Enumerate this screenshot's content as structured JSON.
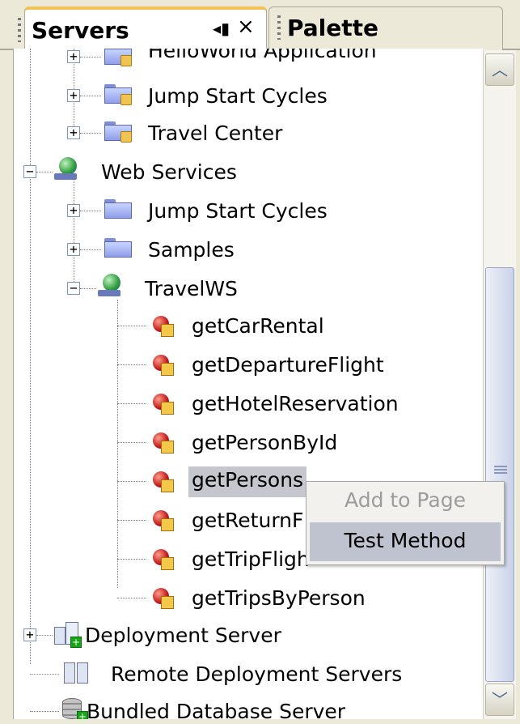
{
  "tabs": {
    "servers_label": "Servers",
    "palette_label": "Palette",
    "minimize_glyph": "◂▮",
    "close_glyph": "×"
  },
  "tree": {
    "hello_world": "HelloWorld Application",
    "jump_start_cycles_1": "Jump Start Cycles",
    "travel_center": "Travel Center",
    "web_services": "Web Services",
    "jump_start_cycles_2": "Jump Start Cycles",
    "samples": "Samples",
    "travel_ws": "TravelWS",
    "methods": [
      "getCarRental",
      "getDepartureFlight",
      "getHotelReservation",
      "getPersonById",
      "getPersons",
      "getReturnF",
      "getTripFligh",
      "getTripsByPerson"
    ],
    "deployment_server": "Deployment Server",
    "remote_deployment_servers": "Remote Deployment Servers",
    "bundled_database_server": "Bundled Database Server"
  },
  "context_menu": {
    "add_to_page": "Add to Page",
    "test_method": "Test Method"
  },
  "scrollbar": {
    "up_glyph": "︿",
    "down_glyph": "﹀"
  },
  "colors": {
    "selection": "#c6c6ce",
    "active_tab_accent": "#f4c156",
    "menu_highlight": "#bfc3cf",
    "disabled_text": "#9c9c9c"
  }
}
